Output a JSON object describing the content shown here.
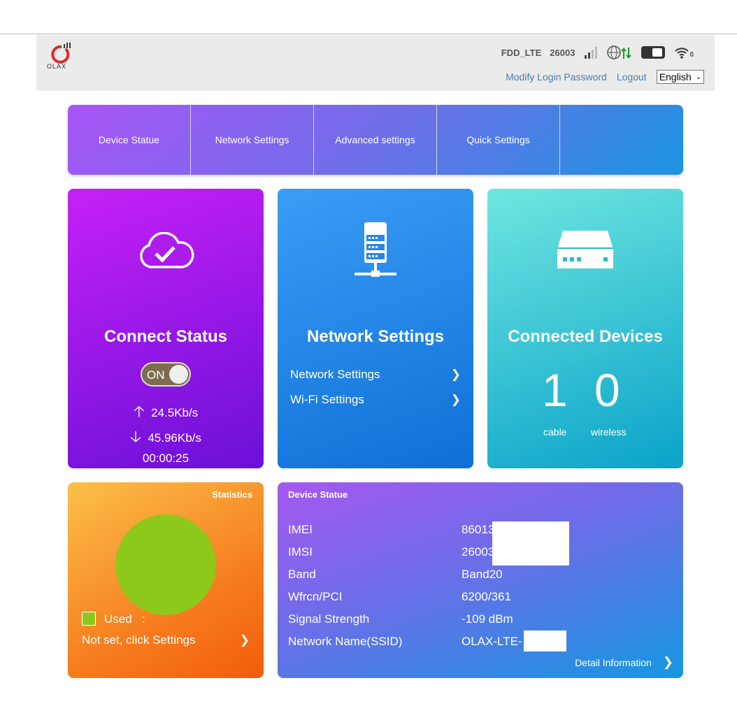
{
  "header": {
    "logo_text": "OLAX",
    "network_type": "FDD_LTE",
    "operator_code": "26003",
    "wifi_clients": "0",
    "modify_password": "Modify Login Password",
    "logout": "Logout",
    "language": "English"
  },
  "nav": [
    "Device Statue",
    "Network Settings",
    "Advanced settings",
    "Quick Settings"
  ],
  "connect": {
    "title": "Connect Status",
    "toggle": "ON",
    "upload": "24.5Kb/s",
    "download": "45.96Kb/s",
    "duration": "00:00:25"
  },
  "network": {
    "title": "Network Settings",
    "links": [
      "Network Settings",
      "Wi-Fi Settings"
    ]
  },
  "devices": {
    "title": "Connected Devices",
    "cable": "1",
    "wireless": "0",
    "cable_label": "cable",
    "wireless_label": "wireless"
  },
  "statistics": {
    "title": "Statistics",
    "legend": "Used",
    "legend_sep": ":",
    "note": "Not set, click Settings",
    "used_color": "#8dc91b"
  },
  "device_status": {
    "title": "Device Statue",
    "rows": [
      {
        "label": "IMEI",
        "value": "86013"
      },
      {
        "label": "IMSI",
        "value": "26003"
      },
      {
        "label": "Band",
        "value": "Band20"
      },
      {
        "label": "Wfrcn/PCI",
        "value": "6200/361"
      },
      {
        "label": "Signal Strength",
        "value": "-109 dBm"
      },
      {
        "label": "Network Name(SSID)",
        "value": "OLAX-LTE-"
      }
    ],
    "detail": "Detail Information"
  }
}
